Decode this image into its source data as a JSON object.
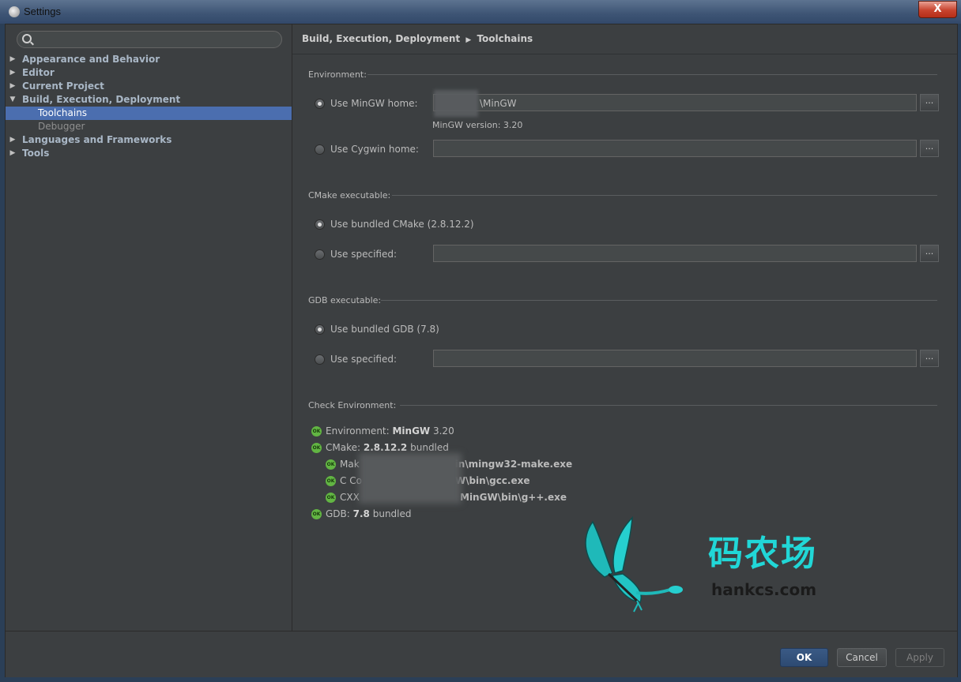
{
  "window": {
    "title": "Settings",
    "close_label": "X"
  },
  "search": {
    "placeholder": ""
  },
  "tree": [
    {
      "label": "Appearance and Behavior",
      "arrow": "▶"
    },
    {
      "label": "Editor",
      "arrow": "▶"
    },
    {
      "label": "Current Project",
      "arrow": "▶"
    },
    {
      "label": "Build, Execution, Deployment",
      "arrow": "▼"
    },
    {
      "label": "Toolchains"
    },
    {
      "label": "Debugger"
    },
    {
      "label": "Languages and Frameworks",
      "arrow": "▶"
    },
    {
      "label": "Tools",
      "arrow": "▶"
    }
  ],
  "breadcrumb": {
    "parent": "Build, Execution, Deployment",
    "sep": "▶",
    "current": "Toolchains"
  },
  "environment": {
    "title": "Environment:",
    "mingw_label": "Use MinGW home:",
    "mingw_value": "\\MinGW",
    "mingw_version": "MinGW version: 3.20",
    "cygwin_label": "Use Cygwin home:",
    "cygwin_value": ""
  },
  "cmake": {
    "title": "CMake executable:",
    "bundled_label": "Use bundled CMake (2.8.12.2)",
    "specified_label": "Use specified:",
    "specified_value": ""
  },
  "gdb": {
    "title": "GDB executable:",
    "bundled_label": "Use bundled GDB (7.8)",
    "specified_label": "Use specified:",
    "specified_value": ""
  },
  "browse_label": "...",
  "check": {
    "title": "Check Environment:",
    "ok": "OK",
    "env_prefix": "Environment: ",
    "env_name": "MinGW",
    "env_version": " 3.20",
    "cmake_prefix": "CMake: ",
    "cmake_version": "2.8.12.2",
    "cmake_suffix": " bundled",
    "make_prefix": "Mak",
    "make_path": "bin\\mingw32-make.exe",
    "c_prefix": "C Co",
    "c_path": "GW\\bin\\gcc.exe",
    "cxx_prefix": "CXX",
    "cxx_path": "MinGW\\bin\\g++.exe",
    "gdb_prefix": "GDB: ",
    "gdb_version": "7.8",
    "gdb_suffix": " bundled"
  },
  "watermark": {
    "title": "码农场",
    "url": "hankcs.com"
  },
  "buttons": {
    "ok": "OK",
    "cancel": "Cancel",
    "apply": "Apply"
  },
  "colors": {
    "accent": "#4b6eaf",
    "ok_icon": "#62b543",
    "watermark": "#21d7d7"
  }
}
